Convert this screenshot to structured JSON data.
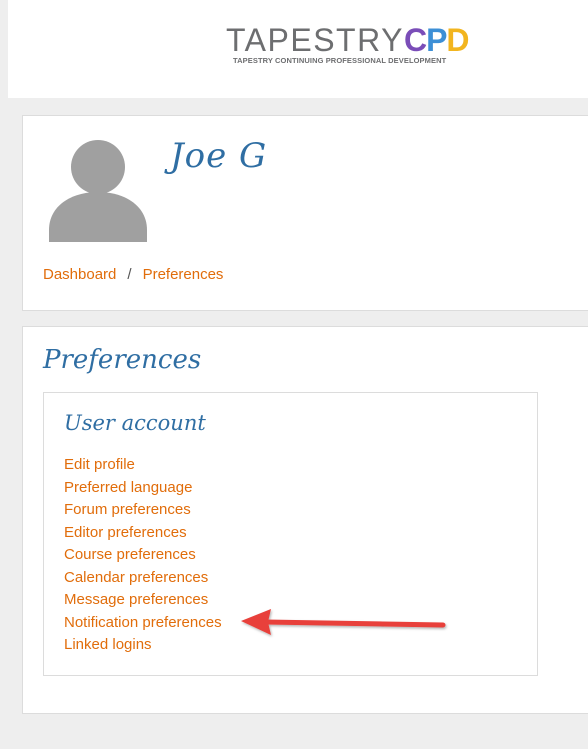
{
  "header": {
    "logo": {
      "brand_main": "TAPESTRY",
      "brand_accent": [
        "C",
        "P",
        "D"
      ],
      "tagline": "TAPESTRY CONTINUING PROFESSIONAL DEVELOPMENT"
    }
  },
  "profile": {
    "name": "Joe G",
    "avatar_icon": "default-user-icon",
    "breadcrumb": {
      "items": [
        "Dashboard",
        "Preferences"
      ],
      "separator": "/"
    }
  },
  "preferences": {
    "title": "Preferences",
    "user_account": {
      "title": "User account",
      "links": [
        "Edit profile",
        "Preferred language",
        "Forum preferences",
        "Editor preferences",
        "Course preferences",
        "Calendar preferences",
        "Message preferences",
        "Notification preferences",
        "Linked logins"
      ]
    }
  },
  "annotation": {
    "icon": "red-arrow-icon",
    "target": "Notification preferences",
    "color": "#e8403a"
  },
  "colors": {
    "link": "#e16d0b",
    "heading": "#2f6ea3",
    "background": "#eeeeee",
    "card": "#ffffff"
  }
}
